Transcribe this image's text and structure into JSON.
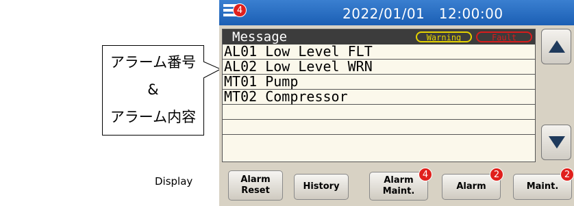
{
  "callout": {
    "line1": "アラーム番号",
    "line2": "&",
    "line3": "アラーム内容"
  },
  "header": {
    "menu_badge": "4",
    "datetime": "2022/01/01　12:00:00"
  },
  "messages": {
    "title": "Message",
    "warning_tag": "Warning",
    "fault_tag": "Fault",
    "rows": [
      "AL01 Low Level FLT",
      "AL02 Low Level WRN",
      "MT01 Pump",
      "MT02 Compressor",
      "",
      "",
      ""
    ]
  },
  "display_label": "Display",
  "buttons": {
    "alarm_reset": [
      "Alarm",
      "Reset"
    ],
    "history": "History",
    "alarm_maint": [
      "Alarm",
      "Maint."
    ],
    "alarm_maint_badge": "4",
    "alarm": "Alarm",
    "alarm_badge": "2",
    "maint": "Maint.",
    "maint_badge": "2"
  },
  "colors": {
    "header_blue": "#1b5fb4",
    "badge_red": "#e0201c",
    "warning_yellow": "#e6d400",
    "fault_red": "#d81c1c",
    "panel_bg": "#d8d2c4",
    "list_bg": "#fbf8eb"
  },
  "icons": {
    "menu": "hamburger-menu-icon",
    "scroll_up": "triangle-up-icon",
    "scroll_down": "triangle-down-icon"
  }
}
